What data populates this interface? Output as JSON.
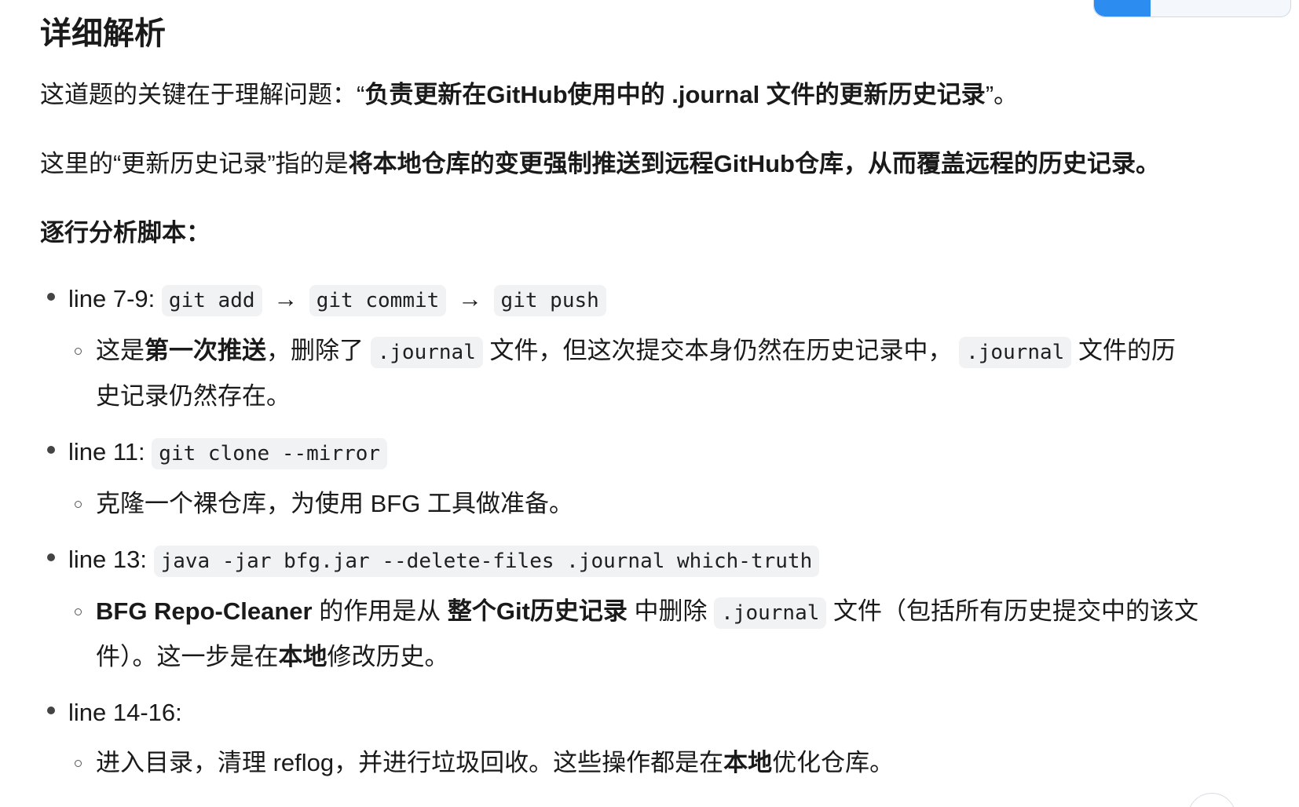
{
  "heading": "详细解析",
  "para1": {
    "lead": "这道题的关键在于理解问题：“",
    "bold": "负责更新在GitHub使用中的 .journal 文件的更新历史记录",
    "tail": "”。"
  },
  "para2": {
    "lead": "这里的“更新历史记录”指的是",
    "bold": "将本地仓库的变更强制推送到远程GitHub仓库，从而覆盖远程的历史记录。"
  },
  "section_title": "逐行分析脚本：",
  "items": [
    {
      "label": "line 7-9:",
      "code1": "git add",
      "arrow1": "→",
      "code2": "git commit",
      "arrow2": "→",
      "code3": "git push",
      "sub": {
        "t1": "这是",
        "b1": "第一次推送",
        "t2": "，删除了",
        "c1": ".journal",
        "t3": "文件，但这次提交本身仍然在历史记录中，",
        "c2": ".journal",
        "t4": "文件的历史记录仍然存在。"
      }
    },
    {
      "label": "line 11:",
      "code1": "git clone --mirror",
      "sub": {
        "t1": "克隆一个裸仓库，为使用 BFG 工具做准备。"
      }
    },
    {
      "label": "line 13:",
      "code1": "java -jar bfg.jar --delete-files .journal which-truth",
      "sub": {
        "b0": "BFG Repo-Cleaner",
        "t1": " 的作用是从 ",
        "b1": "整个Git历史记录",
        "t2": " 中删除",
        "c1": ".journal",
        "t3": "文件（包括所有历史提交中的该文件）。这一步是在",
        "b2": "本地",
        "t4": "修改历史。"
      }
    },
    {
      "label": "line 14-16:",
      "sub": {
        "t1": "进入目录，清理 reflog，并进行垃圾回收。这些操作都是在",
        "b1": "本地",
        "t2": "优化仓库。"
      }
    }
  ]
}
